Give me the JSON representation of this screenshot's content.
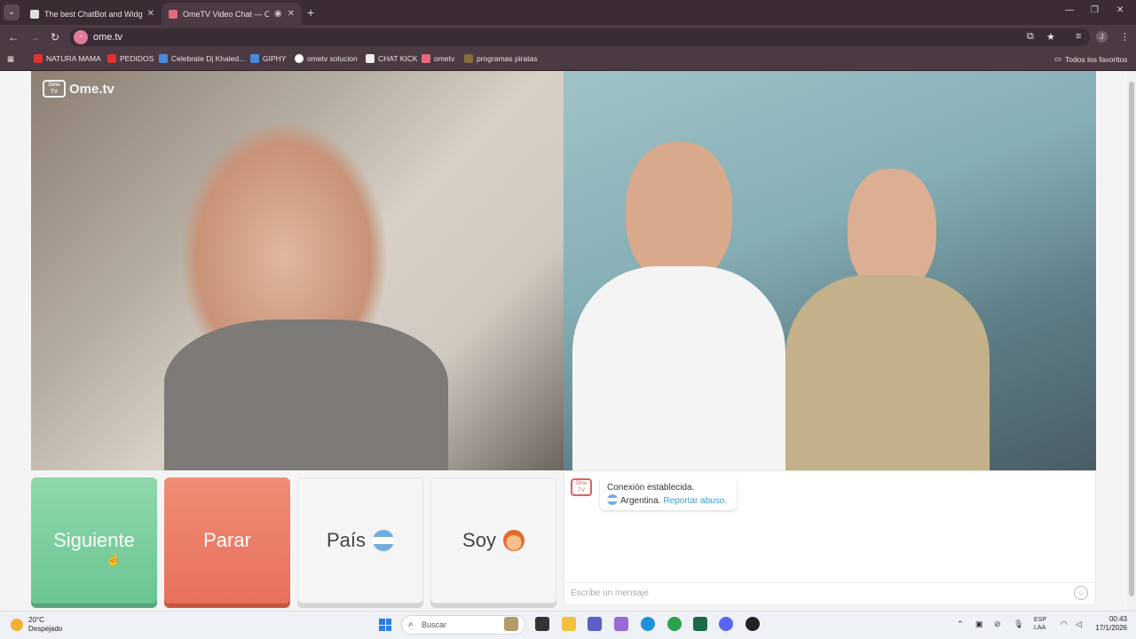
{
  "browser": {
    "tabs": [
      {
        "title": "The best ChatBot and Widgets",
        "active": false
      },
      {
        "title": "OmeTV Video Chat — Ome",
        "active": true
      }
    ],
    "url": "ome.tv",
    "bookmarks": [
      "NATURA MAMA",
      "PEDIDOS",
      "Celebrate Dj Khaled...",
      "GIPHY",
      "ometv solucion",
      "CHAT KICK",
      "ometv",
      "programas piratas"
    ],
    "bookmarks_folder": "Todos los favoritos",
    "profile_initial": "J"
  },
  "page": {
    "logo_text": "Ome.tv",
    "logo_badge": "Ome TV",
    "buttons": {
      "next": "Siguiente",
      "stop": "Parar",
      "country": "País",
      "iam": "Soy"
    },
    "chat": {
      "status": "Conexión establecida.",
      "country": "Argentina.",
      "report": "Reportar abuso.",
      "input_placeholder": "Escribe un mensaje"
    }
  },
  "taskbar": {
    "weather_temp": "20°C",
    "weather_desc": "Despejado",
    "search_placeholder": "Buscar",
    "lang_top": "ESP",
    "lang_bottom": "LAA",
    "time": "00:43",
    "date": "17/1/2026"
  },
  "colors": {
    "next": "#7dcf9f",
    "stop": "#ec7d68",
    "report_link": "#3a9bd6"
  }
}
